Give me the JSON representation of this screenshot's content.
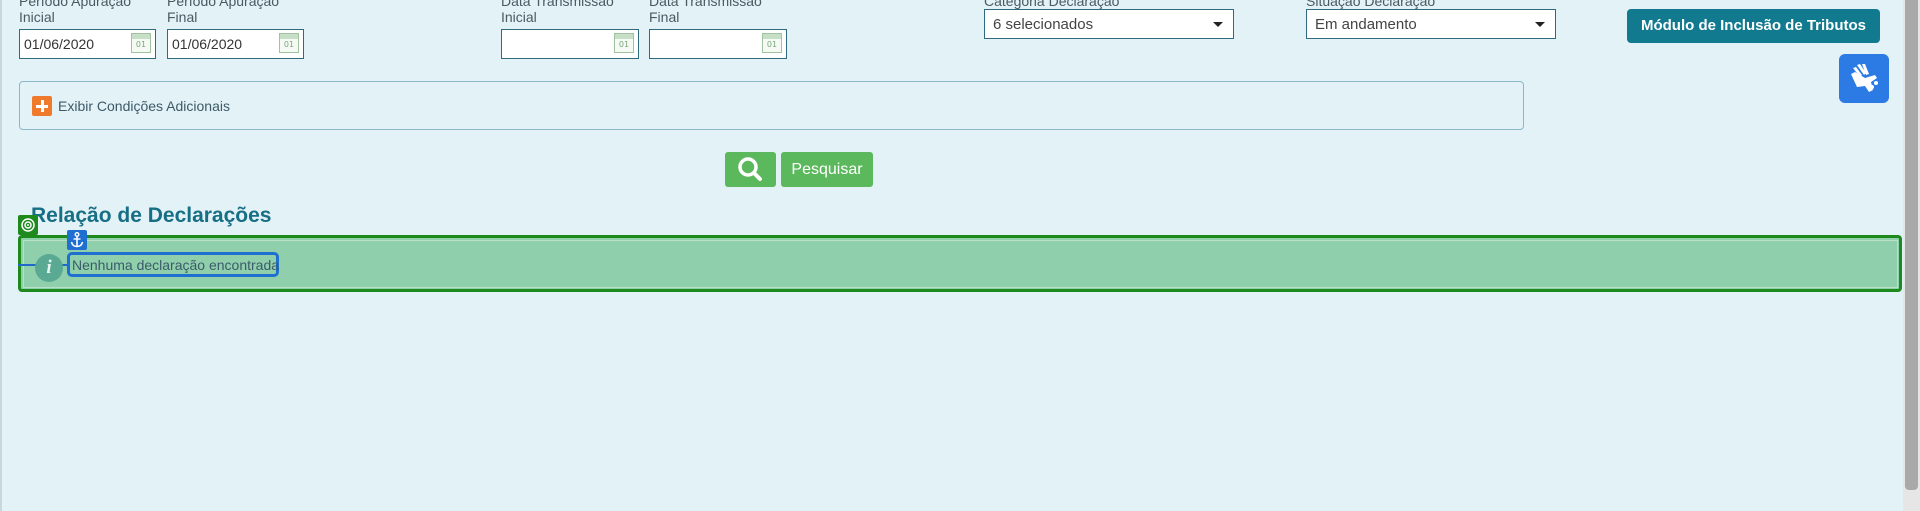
{
  "filters": {
    "periodo_inicial": {
      "label_top": "Período Apuração",
      "label": "Inicial",
      "value": "01/06/2020"
    },
    "periodo_final": {
      "label_top": "Período Apuração",
      "label": "Final",
      "value": "01/06/2020"
    },
    "transmissao_inicial": {
      "label_top": "Data Transmissão",
      "label": "Inicial",
      "value": ""
    },
    "transmissao_final": {
      "label_top": "Data Transmissão",
      "label": "Final",
      "value": ""
    },
    "calendar_text": "01",
    "categoria": {
      "label_top": "Categoria Declaração",
      "selected": "6 selecionados"
    },
    "situacao": {
      "label_top": "Situação Declaração",
      "selected": "Em andamento"
    }
  },
  "header": {
    "modulo_button": "Módulo de Inclusão de Tributos"
  },
  "conditions": {
    "toggle_label": "Exibir Condições Adicionais"
  },
  "search": {
    "button_label": "Pesquisar"
  },
  "results": {
    "title": "Relação de Declarações",
    "info_glyph": "i",
    "empty_message": "Nenhuma declaração encontrada"
  },
  "colors": {
    "background": "#e3f2f7",
    "primary": "#127a8e",
    "success": "#5cb85c",
    "accent_orange": "#f07a2c",
    "highlight_green": "#1e8a1e",
    "highlight_blue": "#1f6fd1"
  },
  "icons": [
    "calendar-icon",
    "chevron-down-icon",
    "plus-icon",
    "search-icon",
    "sign-language-icon",
    "info-icon",
    "target-icon",
    "anchor-icon"
  ]
}
